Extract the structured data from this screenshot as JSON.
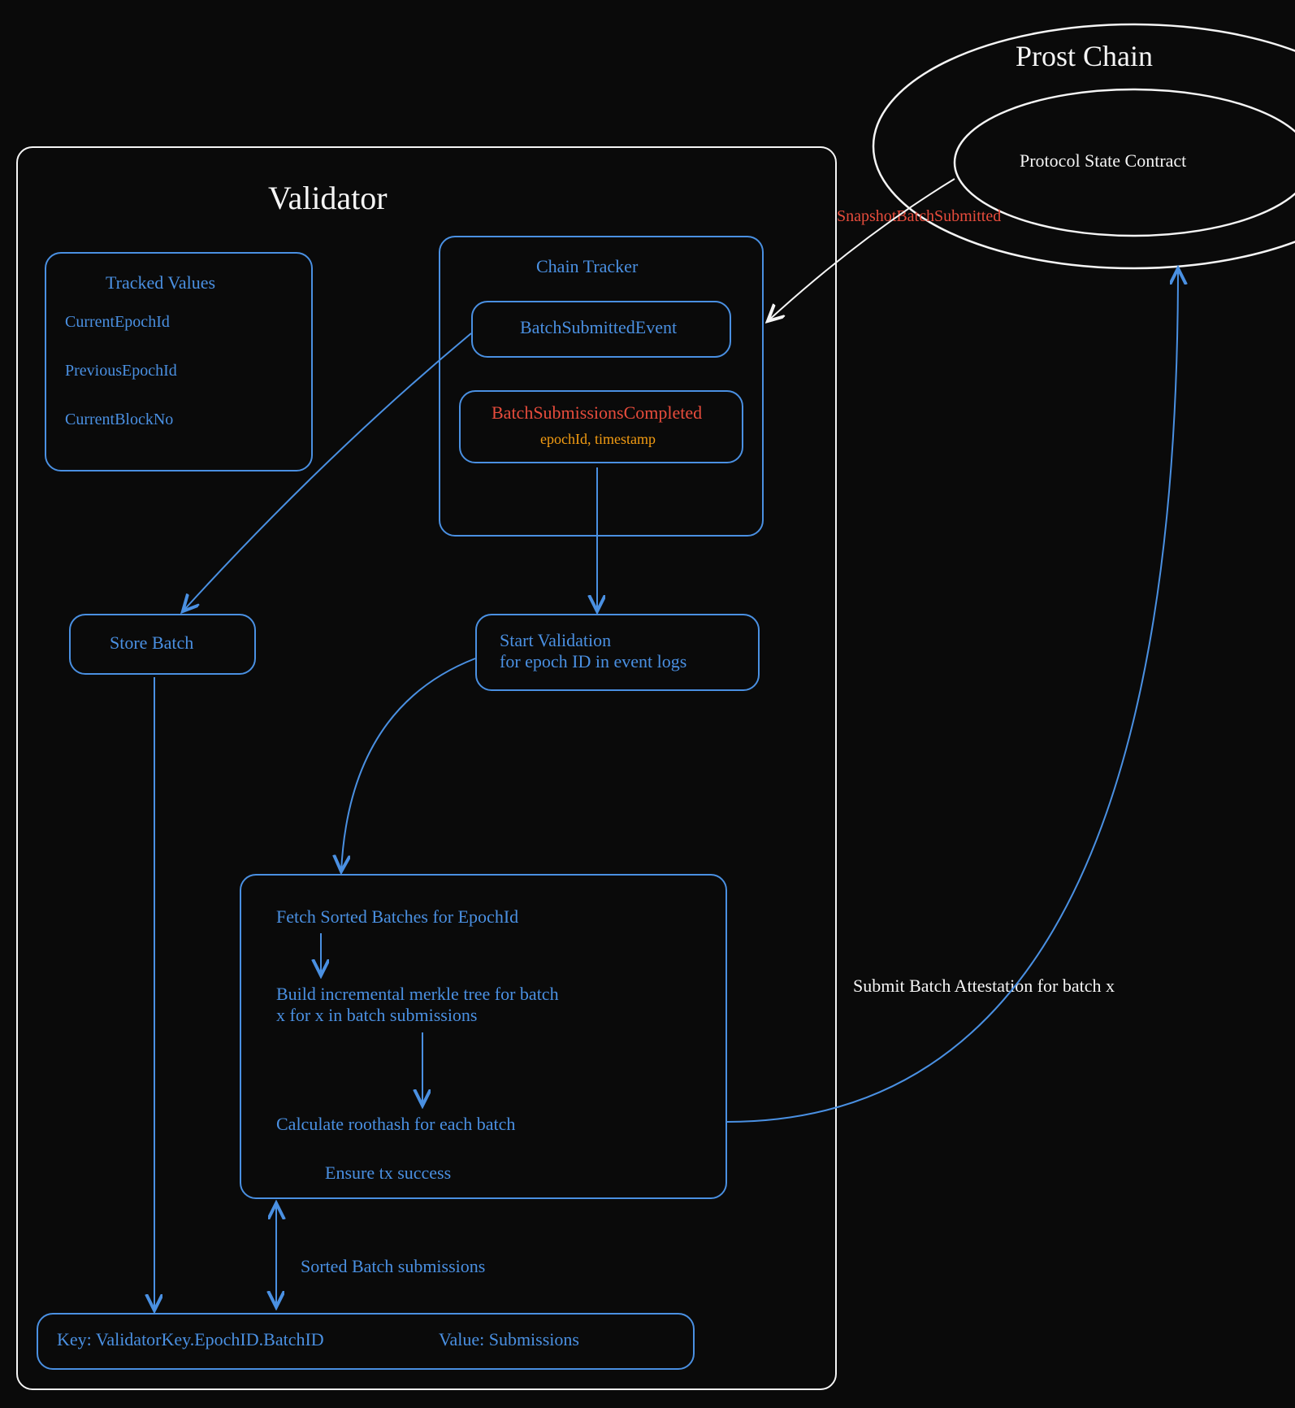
{
  "validator": {
    "title": "Validator",
    "tracked_values": {
      "title": "Tracked Values",
      "items": [
        "CurrentEpochId",
        "PreviousEpochId",
        "CurrentBlockNo"
      ]
    },
    "chain_tracker": {
      "title": "Chain Tracker",
      "batch_submitted_event": "BatchSubmittedEvent",
      "batch_submissions_completed": {
        "title": "BatchSubmissionsCompleted",
        "subtitle": "epochId, timestamp"
      }
    },
    "store_batch": "Store Batch",
    "start_validation": "Start Validation\nfor epoch ID in event logs",
    "process_box": {
      "fetch": "Fetch Sorted Batches for EpochId",
      "build": "Build incremental merkle tree for batch\nx for x in batch submissions",
      "calculate": "Calculate roothash for each batch",
      "ensure": "Ensure tx success"
    },
    "sorted_label": "Sorted Batch submissions",
    "kv_box": {
      "key": "Key: ValidatorKey.EpochID.BatchID",
      "value": "Value: Submissions"
    }
  },
  "prost_chain": {
    "title": "Prost Chain",
    "inner": "Protocol State Contract"
  },
  "edges": {
    "snapshot": "SnapshotBatchSubmitted",
    "submit": "Submit Batch Attestation for batch x"
  }
}
